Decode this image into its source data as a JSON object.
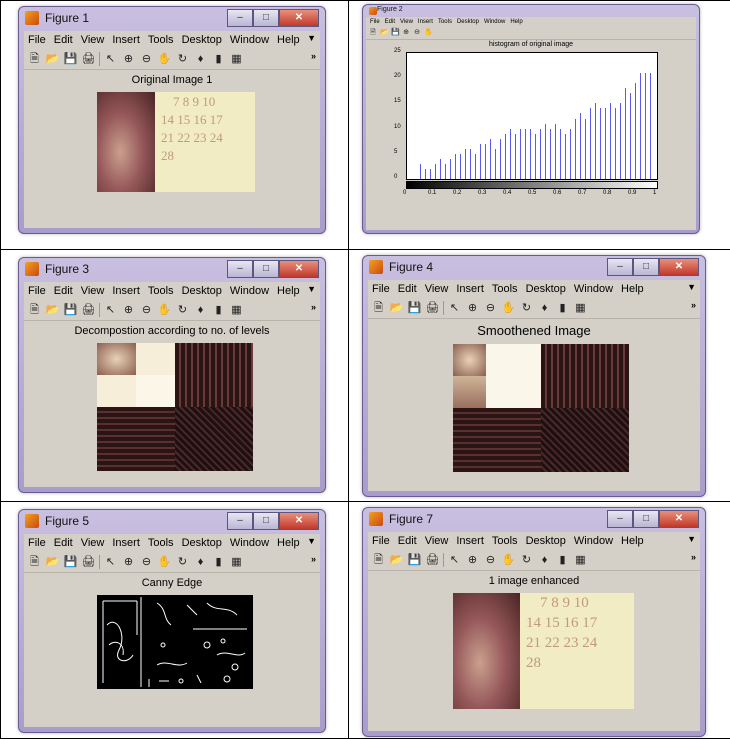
{
  "menu": [
    "File",
    "Edit",
    "View",
    "Insert",
    "Tools",
    "Desktop",
    "Window",
    "Help"
  ],
  "figures": {
    "f1": {
      "title": "Figure 1",
      "axes_title": "Original Image 1"
    },
    "f2": {
      "title": "Figure 2",
      "axes_title": "histogram of original image"
    },
    "f3": {
      "title": "Figure 3",
      "axes_title": "Decompostion according to no. of levels"
    },
    "f4": {
      "title": "Figure 4",
      "axes_title": "Smoothened Image"
    },
    "f5": {
      "title": "Figure 5",
      "axes_title": "Canny Edge"
    },
    "f7": {
      "title": "Figure 7",
      "axes_title": "1 image enhanced"
    }
  },
  "calendar_rows": [
    "7  8  9 10",
    "14 15 16 17",
    "21 22 23 24",
    "28"
  ],
  "chart_data": {
    "type": "bar",
    "title": "histogram of original image",
    "xlim": [
      0,
      1
    ],
    "ylim": [
      0,
      25
    ],
    "xticks": [
      "0",
      "0.1",
      "0.2",
      "0.3",
      "0.4",
      "0.5",
      "0.6",
      "0.7",
      "0.8",
      "0.9",
      "1"
    ],
    "yticks": [
      "0",
      "5",
      "10",
      "15",
      "20",
      "25"
    ],
    "x": [
      0.05,
      0.07,
      0.09,
      0.11,
      0.13,
      0.15,
      0.17,
      0.19,
      0.21,
      0.23,
      0.25,
      0.27,
      0.29,
      0.31,
      0.33,
      0.35,
      0.37,
      0.39,
      0.41,
      0.43,
      0.45,
      0.47,
      0.49,
      0.51,
      0.53,
      0.55,
      0.57,
      0.59,
      0.61,
      0.63,
      0.65,
      0.67,
      0.69,
      0.71,
      0.73,
      0.75,
      0.77,
      0.79,
      0.81,
      0.83,
      0.85,
      0.87,
      0.89,
      0.91,
      0.93,
      0.95,
      0.97
    ],
    "values": [
      3,
      2,
      2,
      3,
      4,
      3,
      4,
      5,
      5,
      6,
      6,
      5,
      7,
      7,
      8,
      6,
      8,
      9,
      10,
      9,
      10,
      10,
      10,
      9,
      10,
      11,
      10,
      11,
      10,
      9,
      10,
      12,
      13,
      12,
      14,
      15,
      14,
      14,
      15,
      14,
      15,
      18,
      17,
      19,
      21,
      21,
      21
    ]
  }
}
